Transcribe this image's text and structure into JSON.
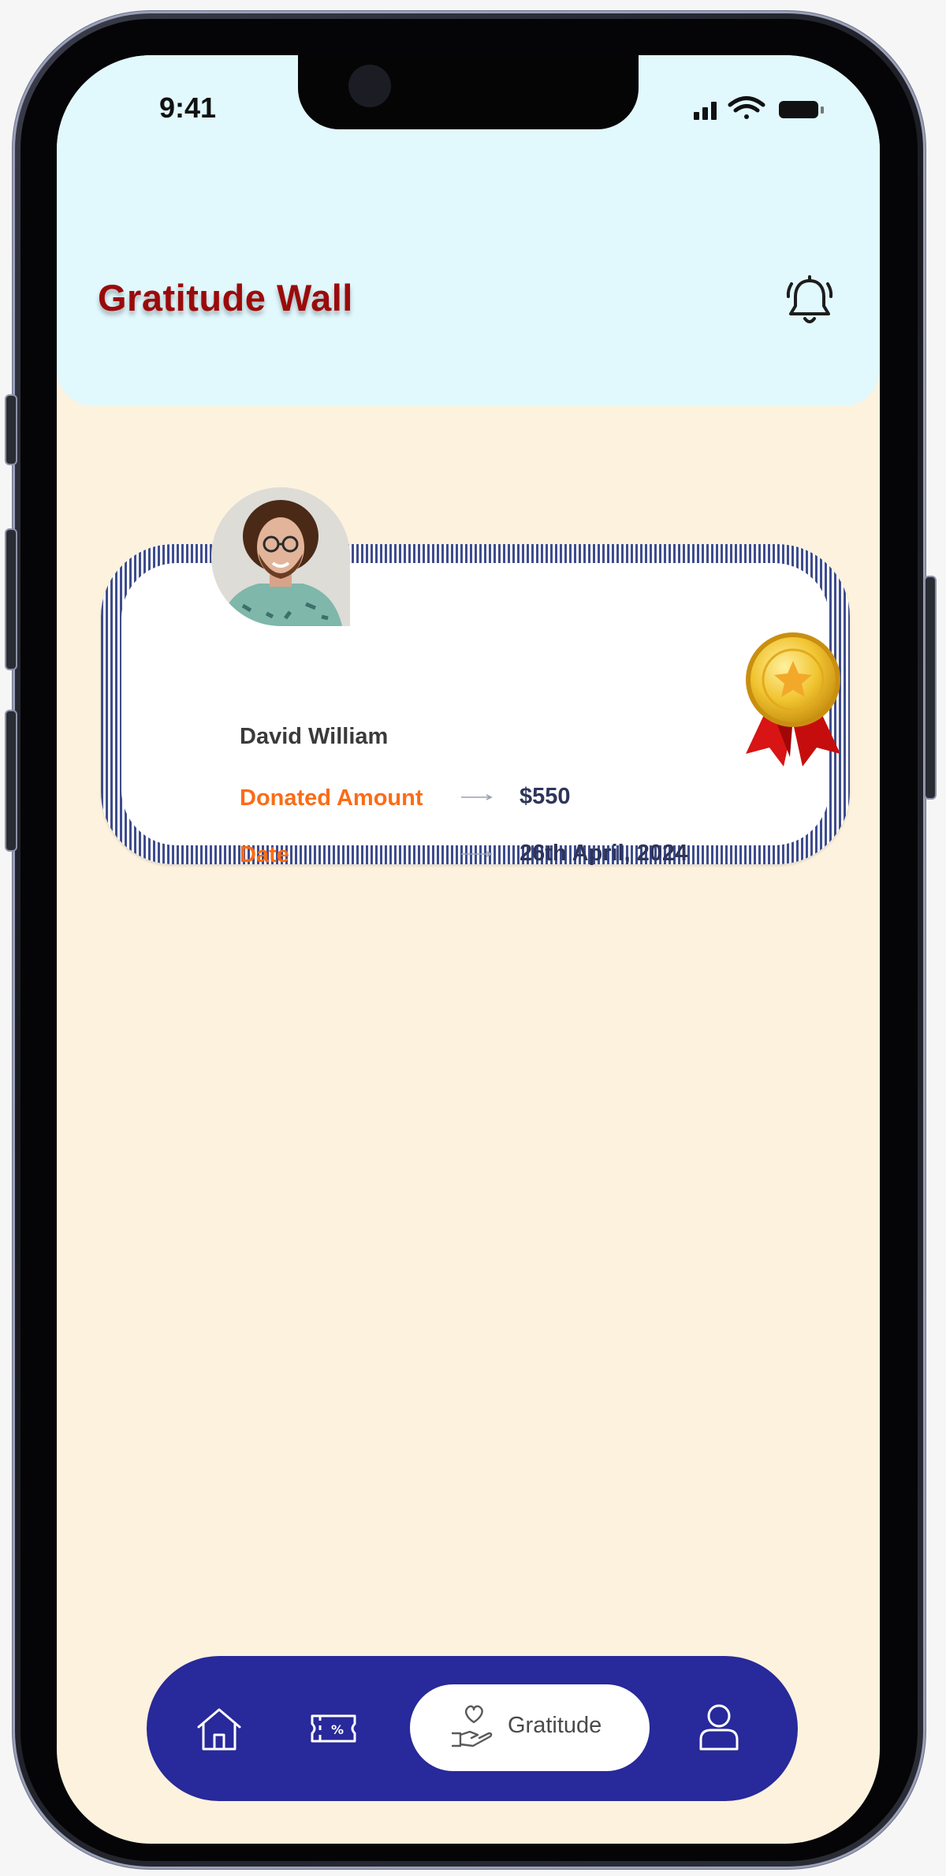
{
  "status_bar": {
    "time": "9:41"
  },
  "header": {
    "title": "Gratitude Wall"
  },
  "card": {
    "donor_name": "David William",
    "rows": [
      {
        "label": "Donated Amount",
        "value": "$550"
      },
      {
        "label": "Date",
        "value": "26th April, 2024"
      }
    ]
  },
  "bottom_nav": {
    "items": [
      {
        "icon": "home-icon"
      },
      {
        "icon": "coupon-icon"
      },
      {
        "icon": "gratitude-icon",
        "label": "Gratitude",
        "active": true
      },
      {
        "icon": "profile-icon"
      }
    ]
  },
  "colors": {
    "header_bg": "#e1f8fd",
    "page_bg": "#fdf2de",
    "title": "#9b0a0a",
    "label_orange": "#fb6c15",
    "value_navy": "#2f3559",
    "nav_bg": "#28299a"
  }
}
